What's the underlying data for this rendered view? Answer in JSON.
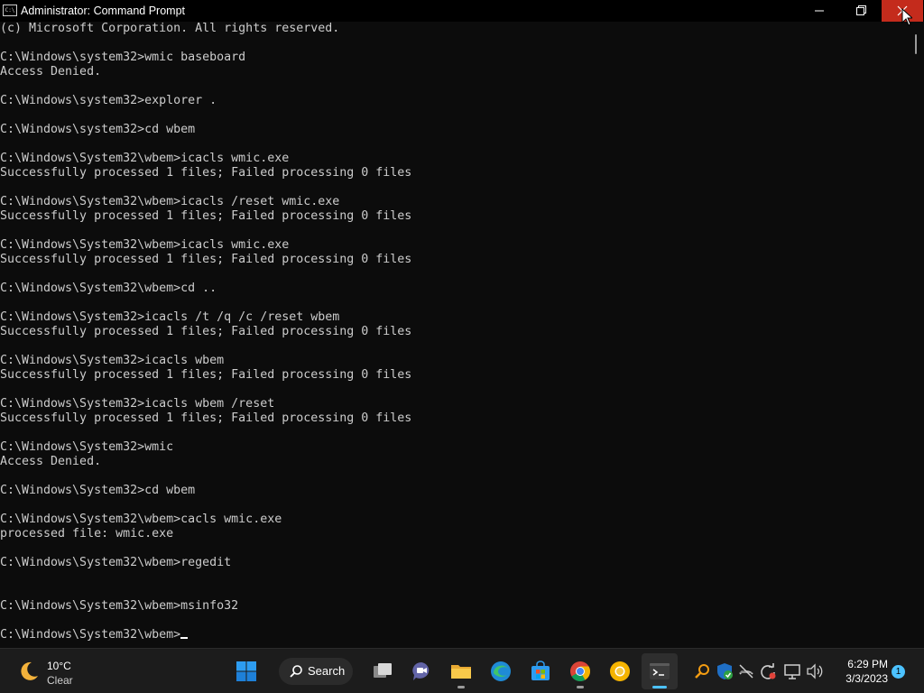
{
  "window": {
    "title": "Administrator: Command Prompt",
    "icon_name": "command-prompt-icon",
    "icon_text": "C:\\"
  },
  "console": {
    "lines": [
      "(c) Microsoft Corporation. All rights reserved.",
      "",
      "C:\\Windows\\system32>wmic baseboard",
      "Access Denied.",
      "",
      "C:\\Windows\\system32>explorer .",
      "",
      "C:\\Windows\\system32>cd wbem",
      "",
      "C:\\Windows\\System32\\wbem>icacls wmic.exe",
      "Successfully processed 1 files; Failed processing 0 files",
      "",
      "C:\\Windows\\System32\\wbem>icacls /reset wmic.exe",
      "Successfully processed 1 files; Failed processing 0 files",
      "",
      "C:\\Windows\\System32\\wbem>icacls wmic.exe",
      "Successfully processed 1 files; Failed processing 0 files",
      "",
      "C:\\Windows\\System32\\wbem>cd ..",
      "",
      "C:\\Windows\\System32>icacls /t /q /c /reset wbem",
      "Successfully processed 1 files; Failed processing 0 files",
      "",
      "C:\\Windows\\System32>icacls wbem",
      "Successfully processed 1 files; Failed processing 0 files",
      "",
      "C:\\Windows\\System32>icacls wbem /reset",
      "Successfully processed 1 files; Failed processing 0 files",
      "",
      "C:\\Windows\\System32>wmic",
      "Access Denied.",
      "",
      "C:\\Windows\\System32>cd wbem",
      "",
      "C:\\Windows\\System32\\wbem>cacls wmic.exe",
      "processed file: wmic.exe",
      "",
      "C:\\Windows\\System32\\wbem>regedit",
      "",
      "",
      "C:\\Windows\\System32\\wbem>msinfo32",
      ""
    ],
    "prompt": "C:\\Windows\\System32\\wbem>"
  },
  "taskbar": {
    "weather": {
      "temp": "10°C",
      "desc": "Clear",
      "icon": "moon-icon"
    },
    "search_label": "Search",
    "pinned": [
      {
        "name": "start-button",
        "icon": "windows-logo-icon"
      },
      {
        "name": "taskbar-search-button",
        "icon": "search-icon"
      },
      {
        "name": "task-view-button",
        "icon": "task-view-icon"
      },
      {
        "name": "chat-button",
        "icon": "teams-chat-icon"
      },
      {
        "name": "file-explorer-button",
        "icon": "folder-icon"
      },
      {
        "name": "edge-button",
        "icon": "edge-icon"
      },
      {
        "name": "store-button",
        "icon": "store-icon"
      },
      {
        "name": "chrome-button",
        "icon": "chrome-icon"
      },
      {
        "name": "chrome-canary-button",
        "icon": "chrome-canary-icon"
      },
      {
        "name": "terminal-button",
        "icon": "terminal-icon"
      }
    ],
    "tray_icons": [
      "search-tray-icon",
      "defender-icon",
      "network-off-icon",
      "sync-icon",
      "display-icon",
      "volume-icon"
    ],
    "clock": {
      "time": "6:29 PM",
      "date": "3/3/2023"
    },
    "notification_count": "1"
  },
  "colors": {
    "console_bg": "#0c0c0c",
    "console_fg": "#cccccc",
    "close_button": "#c42b1c",
    "taskbar_bg": "#1c1c1c",
    "accent": "#4cc2ff"
  }
}
